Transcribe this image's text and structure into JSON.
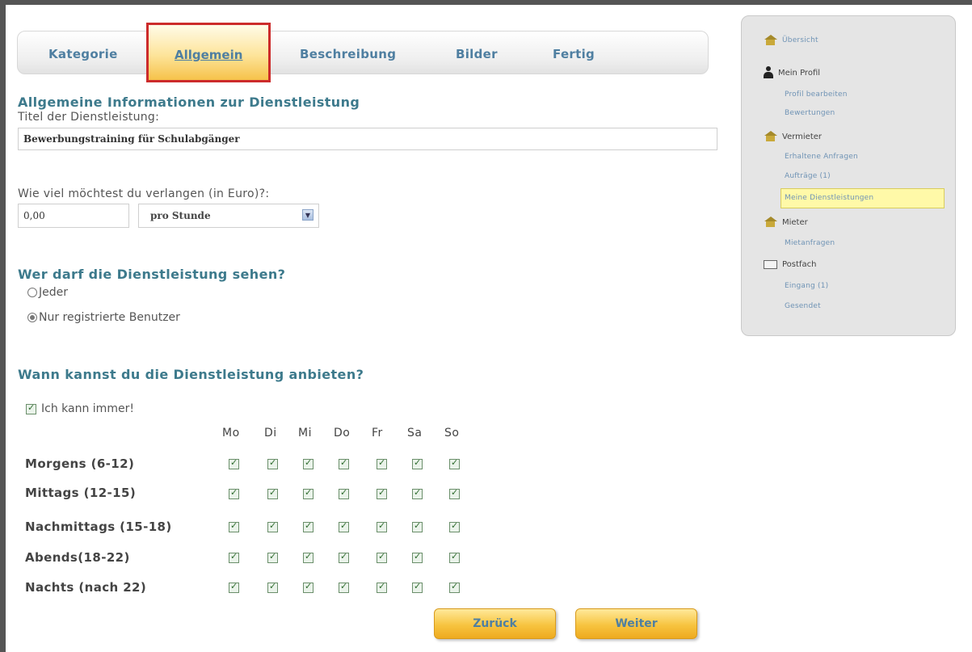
{
  "tabs": [
    {
      "label": "Kategorie"
    },
    {
      "label": "Allgemein"
    },
    {
      "label": "Beschreibung"
    },
    {
      "label": "Bilder"
    },
    {
      "label": "Fertig"
    }
  ],
  "section_general": {
    "heading": "Allgemeine Informationen zur Dienstleistung",
    "title_label": "Titel der Dienstleistung:",
    "title_value": "Bewerbungstraining für Schulabgänger"
  },
  "pricing": {
    "label": "Wie viel möchtest du verlangen (in Euro)?:",
    "price_value": "0,00",
    "unit_selected": "pro Stunde"
  },
  "visibility": {
    "heading": "Wer darf die Dienstleistung sehen?",
    "options": [
      "Jeder",
      "Nur registrierte Benutzer"
    ],
    "selected": "Nur registrierte Benutzer"
  },
  "availability": {
    "heading": "Wann kannst du die Dienstleistung anbieten?",
    "always_label": "Ich kann immer!",
    "always_checked": true,
    "days": [
      "Mo",
      "Di",
      "Mi",
      "Do",
      "Fr",
      "Sa",
      "So"
    ],
    "slots": [
      {
        "label": "Morgens (6-12)"
      },
      {
        "label": "Mittags (12-15)"
      },
      {
        "label": "Nachmittags (15-18)"
      },
      {
        "label": "Abends(18-22)"
      },
      {
        "label": "Nachts (nach 22)"
      }
    ],
    "all_checked": true
  },
  "buttons": {
    "back": "Zurück",
    "next": "Weiter"
  },
  "sidebar": {
    "overview": "Übersicht",
    "profile": {
      "label": "Mein Profil",
      "items": [
        "Profil bearbeiten",
        "Bewertungen"
      ]
    },
    "landlord": {
      "label": "Vermieter",
      "items": [
        "Erhaltene Anfragen",
        "Aufträge (1)",
        "Meine Dienstleistungen"
      ]
    },
    "tenant": {
      "label": "Mieter",
      "items": [
        "Mietanfragen"
      ]
    },
    "mailbox": {
      "label": "Postfach",
      "items": [
        "Eingang (1)",
        "Gesendet"
      ]
    }
  }
}
